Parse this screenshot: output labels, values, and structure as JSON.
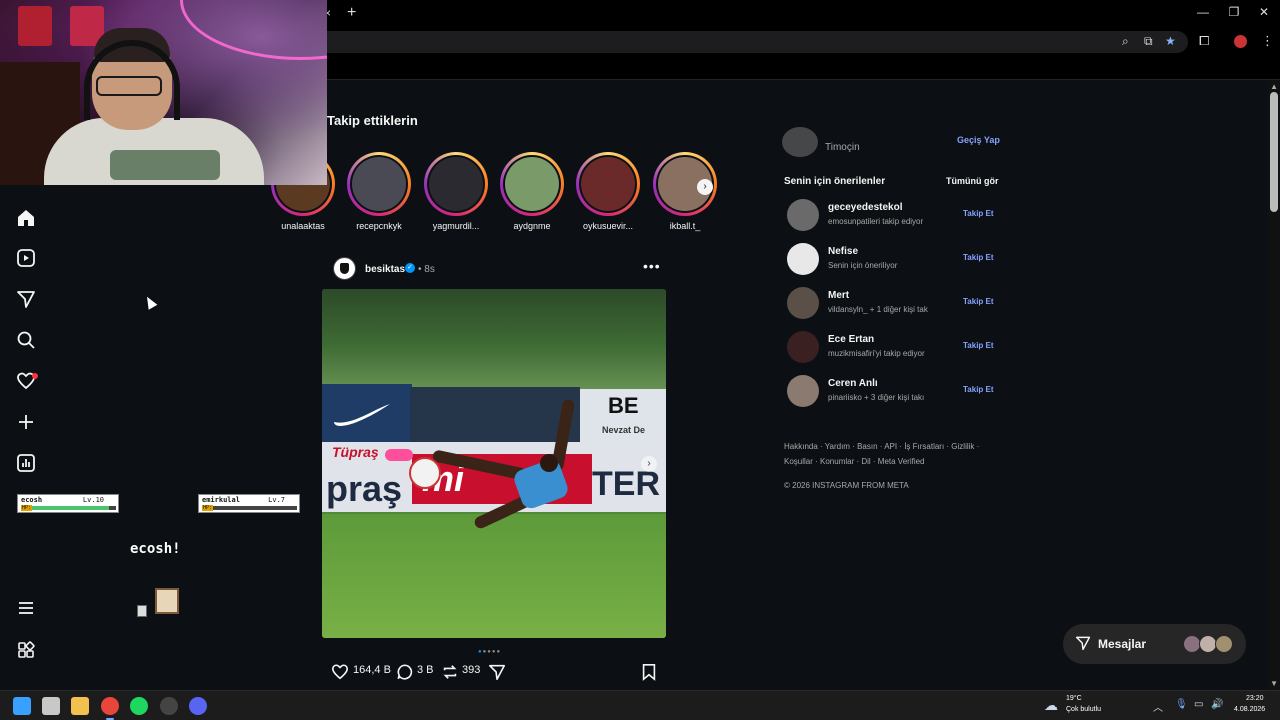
{
  "browser": {
    "tab_close": "×",
    "new_tab": "+",
    "window_controls": [
      "—",
      "❐",
      "✕"
    ],
    "omnibox_icons": [
      "zoom-icon",
      "install-icon",
      "star-icon"
    ]
  },
  "nav": {
    "items": [
      "home-icon",
      "reels-icon",
      "direct-icon",
      "search-icon",
      "heart-icon",
      "create-icon",
      "insights-icon",
      "menu-icon",
      "apps-icon"
    ]
  },
  "game": {
    "player1": {
      "name": "ecosh",
      "level": "Lv.10",
      "hp_label": "HP:",
      "hp_fraction": 0.92
    },
    "player2": {
      "name": "emirkulal",
      "level": "Lv.7",
      "hp_label": "HP:",
      "hp_fraction": 0.0
    },
    "caption": "ecosh!"
  },
  "stories": {
    "title": "Takip ettiklerin",
    "items": [
      {
        "username": "unalaaktas",
        "color": "#5a3a20"
      },
      {
        "username": "recepcnkyk",
        "color": "#4a4a55"
      },
      {
        "username": "yagmurdil...",
        "color": "#2a2a30"
      },
      {
        "username": "aydgnme",
        "color": "#7a9a6a"
      },
      {
        "username": "oykusuevir...",
        "color": "#6a2a2a"
      },
      {
        "username": "ikball.t_",
        "color": "#8a7060"
      }
    ],
    "next": "›"
  },
  "post": {
    "username": "besiktas",
    "verified": "✓",
    "time": "• 8s",
    "more": "•••",
    "image_texts": {
      "board": "BE",
      "board_sub": "Nevzat De",
      "sponsor1": "Tüpraş",
      "sponsor2": "praş",
      "sponsor3": "mi",
      "sponsor4": "TER"
    },
    "next": "›",
    "likes": "164,4 B",
    "comments": "3 B",
    "reposts": "393",
    "carousel_index": 1,
    "carousel_count": 5
  },
  "sidebar": {
    "me_name": "Timoçin",
    "switch_label": "Geçiş Yap",
    "suggest_title": "Senin için önerilenler",
    "see_all": "Tümünü gör",
    "suggestions": [
      {
        "name": "geceyedestekol",
        "sub": "emosunpatileri takip ediyor",
        "follow": "Takip Et",
        "color": "#6a6a6a"
      },
      {
        "name": "Nefise",
        "sub": "Senin için öneriliyor",
        "follow": "Takip Et",
        "color": "#e8e8e8"
      },
      {
        "name": "Mert",
        "sub": "vildansyln_ + 1 diğer kişi tak",
        "follow": "Takip Et",
        "color": "#5a5048"
      },
      {
        "name": "Ece Ertan",
        "sub": "muzikmisafiri'yi takip ediyor",
        "follow": "Takip Et",
        "color": "#3a2020"
      },
      {
        "name": "Ceren Anlı",
        "sub": "pinariisko + 3 diğer kişi takı",
        "follow": "Takip Et",
        "color": "#8a7a70"
      }
    ],
    "footer_links": "Hakkında · Yardım · Basın · API · İş Fırsatları · Gizlilik · Koşullar · Konumlar · Dil · Meta Verified",
    "copyright": "© 2026 INSTAGRAM FROM META"
  },
  "messages": {
    "label": "Mesajlar",
    "avatar_colors": [
      "#8a7080",
      "#c0b0a8",
      "#a09070"
    ]
  },
  "taskbar": {
    "weather_temp": "19°C",
    "weather_desc": "Çok bulutlu",
    "time": "23:20",
    "date": "4.08.2026",
    "apps": [
      {
        "name": "windows-start-icon",
        "color": "#3aa0ff"
      },
      {
        "name": "task-view-icon",
        "color": "#c8c8c8"
      },
      {
        "name": "file-explorer-icon",
        "color": "#f2c14e"
      },
      {
        "name": "chrome-icon",
        "color": "#e8453c"
      },
      {
        "name": "spotify-icon",
        "color": "#1ed760"
      },
      {
        "name": "obs-icon",
        "color": "#444444"
      },
      {
        "name": "discord-icon",
        "color": "#5865f2"
      }
    ]
  }
}
